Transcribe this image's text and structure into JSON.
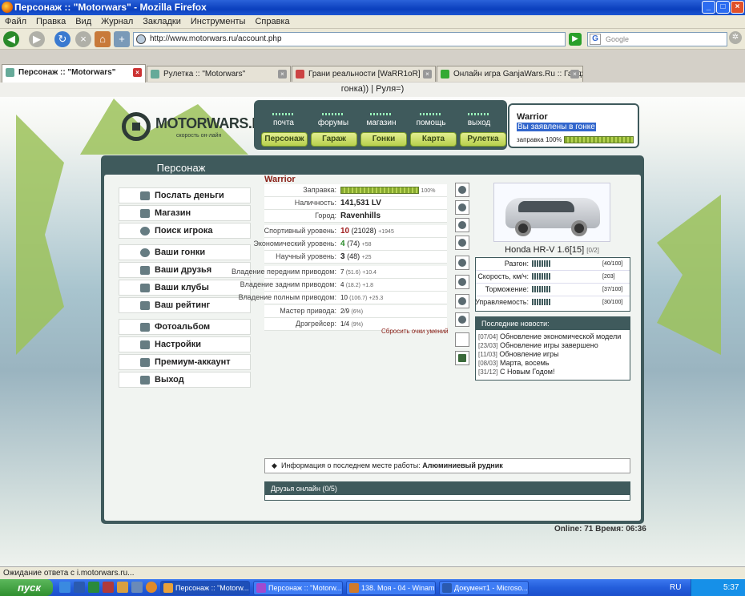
{
  "window": {
    "title": "Персонаж :: \"Motorwars\" - Mozilla Firefox"
  },
  "menu": [
    "Файл",
    "Правка",
    "Вид",
    "Журнал",
    "Закладки",
    "Инструменты",
    "Справка"
  ],
  "url": "http://www.motorwars.ru/account.php",
  "search_placeholder": "Google",
  "tabs": [
    "Персонаж :: \"Motorwars\"",
    "Рулетка :: \"Motorwars\"",
    "Грани реальности [WaRR1oR]",
    "Онлайн игра GanjaWars.Ru :: Гандж..."
  ],
  "marquee": "гонка)) | Руля=)",
  "logo": {
    "text": "MOTORWARS.RU",
    "sub": "скорость он-лайн"
  },
  "topnav": [
    "почта",
    "форумы",
    "магазин",
    "помощь",
    "выход"
  ],
  "topbuttons": [
    "Персонаж",
    "Гараж",
    "Гонки",
    "Карта",
    "Рулетка"
  ],
  "user": {
    "name": "Warrior",
    "status": "Вы заявлены в гонке",
    "fuel": "заправка 100%"
  },
  "panel_title": "Персонаж",
  "left_menu": [
    "Послать деньги",
    "Магазин",
    "Поиск игрока",
    "Ваши гонки",
    "Ваши друзья",
    "Ваши клубы",
    "Ваш рейтинг",
    "Фотоальбом",
    "Настройки",
    "Премиум-аккаунт",
    "Выход"
  ],
  "char": {
    "name": "Warrior",
    "fuel_label": "Заправка:",
    "fuel_value": "100%",
    "cash_label": "Наличность:",
    "cash_value": "141,531 LV",
    "city_label": "Город:",
    "city_value": "Ravenhills",
    "sport_label": "Спортивный уровень:",
    "sport_lvl": "10",
    "sport_pts": "(21028)",
    "sport_d": "+1945",
    "econ_label": "Экономический уровень:",
    "econ_lvl": "4",
    "econ_pts": "(74)",
    "econ_d": "+58",
    "sci_label": "Научный уровень:",
    "sci_lvl": "3",
    "sci_pts": "(48)",
    "sci_d": "+25",
    "fwd_label": "Владение передним приводом:",
    "fwd_lvl": "7",
    "fwd_pts": "(51.6)",
    "fwd_d": "+10.4",
    "rwd_label": "Владение задним приводом:",
    "rwd_lvl": "4",
    "rwd_pts": "(18.2)",
    "rwd_d": "+1.8",
    "awd_label": "Владение полным приводом:",
    "awd_lvl": "10",
    "awd_pts": "(106.7)",
    "awd_d": "+25.3",
    "master_label": "Мастер привода:",
    "master_value": "2/9",
    "master_pct": "(6%)",
    "drift_label": "Дрэгрейсер:",
    "drift_value": "1/4",
    "drift_pct": "(9%)",
    "reset": "Сбросить очки умений"
  },
  "car": {
    "name": "Honda HR-V 1.6[15]",
    "class": "[0/2]",
    "params": [
      {
        "label": "Разгон:",
        "value": "[40/100]"
      },
      {
        "label": "Скорость, км/ч:",
        "value": "[203]"
      },
      {
        "label": "Торможение:",
        "value": "[37/100]"
      },
      {
        "label": "Управляемость:",
        "value": "[30/100]"
      }
    ]
  },
  "news": {
    "title": "Последние новости:",
    "items": [
      {
        "date": "[07/04]",
        "text": "Обновление экономической модели"
      },
      {
        "date": "[23/03]",
        "text": "Обновление игры завершено"
      },
      {
        "date": "[11/03]",
        "text": "Обновление игры"
      },
      {
        "date": "[08/03]",
        "text": "Марта, восемь"
      },
      {
        "date": "[31/12]",
        "text": "С Новым Годом!"
      }
    ]
  },
  "work": {
    "label": "Информация о последнем месте работы:",
    "value": "Алюминиевый рудник"
  },
  "friends": "Друзья онлайн (0/5)",
  "online": "Online: 71  Время: 06:36",
  "statusbar": "Ожидание ответа с i.motorwars.ru...",
  "taskbar": {
    "start": "пуск",
    "items": [
      "Персонаж :: \"Motorw...",
      "Персонаж :: \"Motorw...",
      "138. Моя - 04 - Winamp",
      "Документ1 - Microso..."
    ],
    "lang": "RU",
    "time": "5:37"
  }
}
